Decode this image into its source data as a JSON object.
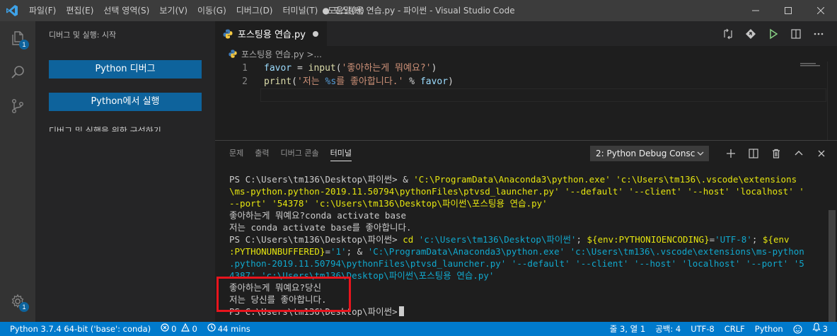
{
  "colors": {
    "statusbar": "#007acc",
    "button": "#0e639c",
    "highlight": "#e8141d",
    "titlebar": "#3c3c3c"
  },
  "menu": [
    "파일(F)",
    "편집(E)",
    "선택 영역(S)",
    "보기(V)",
    "이동(G)",
    "디버그(D)",
    "터미널(T)",
    "도움말(H)"
  ],
  "window_title": "● 포스팅용 연습.py - 파이썬 - Visual Studio Code",
  "activity": {
    "explorer_badge": "1",
    "settings_badge": "1"
  },
  "sidebar": {
    "title": "디버그 및 실행: 시작",
    "debug_button": "Python 디버그",
    "run_button": "Python에서 실행",
    "cut_text": "디버그 및 실행을 위한 구성하기"
  },
  "editor": {
    "tab_label": "포스팅용 연습.py",
    "breadcrumb": "포스팅용 연습.py >..."
  },
  "code": [
    {
      "ln": "1",
      "tokens": [
        {
          "t": "favor",
          "c": "t-kw"
        },
        {
          "t": " = ",
          "c": "t-op"
        },
        {
          "t": "input",
          "c": "t-fn"
        },
        {
          "t": "(",
          "c": "t-op"
        },
        {
          "t": "'좋아하는게 뭐예요?'",
          "c": "t-str"
        },
        {
          "t": ")",
          "c": "t-op"
        }
      ]
    },
    {
      "ln": "2",
      "tokens": [
        {
          "t": "print",
          "c": "t-fn"
        },
        {
          "t": "(",
          "c": "t-op"
        },
        {
          "t": "'저는 ",
          "c": "t-str"
        },
        {
          "t": "%s",
          "c": "t-fmt"
        },
        {
          "t": "를 좋아합니다.'",
          "c": "t-str"
        },
        {
          "t": " % ",
          "c": "t-op"
        },
        {
          "t": "favor",
          "c": "t-kw"
        },
        {
          "t": ")",
          "c": "t-op"
        }
      ]
    }
  ],
  "panel": {
    "tabs": [
      "문제",
      "출력",
      "디버그 콘솔",
      "터미널"
    ],
    "active_tab": "터미널",
    "terminal_select": "2: Python Debug Consc"
  },
  "terminal": [
    [
      {
        "t": "PS C:\\Users\\tm136\\Desktop\\파이썬> & ",
        "c": ""
      },
      {
        "t": "'C:\\ProgramData\\Anaconda3\\python.exe' 'c:\\Users\\tm136\\.vscode\\extensions",
        "c": "c-y"
      }
    ],
    [
      {
        "t": "\\ms-python.python-2019.11.50794\\pythonFiles\\ptvsd_launcher.py' '--default' '--client' '--host' 'localhost' '",
        "c": "c-y"
      }
    ],
    [
      {
        "t": "--port' '54378' 'c:\\Users\\tm136\\Desktop\\파이썬\\포스팅용 연습.py'",
        "c": "c-y"
      }
    ],
    [
      {
        "t": "좋아하는게 뭐예요?conda activate base",
        "c": ""
      }
    ],
    [
      {
        "t": "저는 conda activate base를 좋아합니다.",
        "c": ""
      }
    ],
    [
      {
        "t": "PS C:\\Users\\tm136\\Desktop\\파이썬> ",
        "c": ""
      },
      {
        "t": "cd ",
        "c": "c-y"
      },
      {
        "t": "'c:\\Users\\tm136\\Desktop\\파이썬'",
        "c": "c-c"
      },
      {
        "t": "; ",
        "c": ""
      },
      {
        "t": "${env:PYTHONIOENCODING}",
        "c": "c-y"
      },
      {
        "t": "=",
        "c": ""
      },
      {
        "t": "'UTF-8'",
        "c": "c-c"
      },
      {
        "t": "; ",
        "c": ""
      },
      {
        "t": "${env",
        "c": "c-y"
      }
    ],
    [
      {
        "t": ":PYTHONUNBUFFERED}",
        "c": "c-y"
      },
      {
        "t": "=",
        "c": ""
      },
      {
        "t": "'1'",
        "c": "c-c"
      },
      {
        "t": "; & ",
        "c": ""
      },
      {
        "t": "'C:\\ProgramData\\Anaconda3\\python.exe' 'c:\\Users\\tm136\\.vscode\\extensions\\ms-python",
        "c": "c-c"
      }
    ],
    [
      {
        "t": ".python-2019.11.50794\\pythonFiles\\ptvsd_launcher.py' '--default' '--client' '--host' 'localhost' '--port' '5",
        "c": "c-c"
      }
    ],
    [
      {
        "t": "4387' 'c:\\Users\\tm136\\Desktop\\파이썬\\포스팅용 연습.py'",
        "c": "c-c"
      }
    ],
    [
      {
        "t": "좋아하는게 뭐예요?당신",
        "c": ""
      }
    ],
    [
      {
        "t": "저는 당신를 좋아합니다.",
        "c": ""
      }
    ],
    [
      {
        "t": "PS C:\\Users\\tm136\\Desktop\\파이썬>",
        "c": ""
      }
    ]
  ],
  "statusbar": {
    "interpreter": "Python 3.7.4 64-bit ('base': conda)",
    "errors": "0",
    "warnings": "0",
    "time": "44 mins",
    "position": "줄 3, 열 1",
    "spaces": "공백: 4",
    "encoding": "UTF-8",
    "eol": "CRLF",
    "language": "Python",
    "bell_count": "3"
  }
}
